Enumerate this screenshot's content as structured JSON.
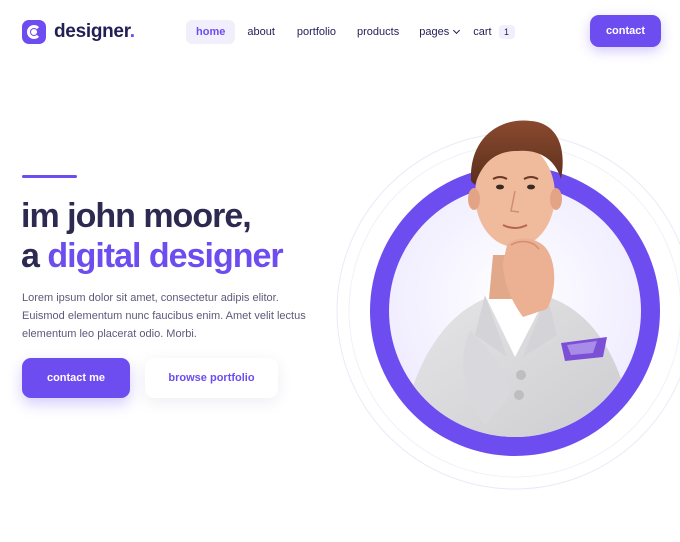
{
  "header": {
    "logo_text": "designer",
    "logo_dot": ".",
    "nav": {
      "home": "home",
      "about": "about",
      "portfolio": "portfolio",
      "products": "products",
      "pages": "pages",
      "cart": "cart",
      "cart_count": "1"
    },
    "contact_label": "contact"
  },
  "hero": {
    "line1": "im john moore,",
    "line2_prefix": "a ",
    "line2_highlight": "digital designer",
    "body": "Lorem ipsum dolor sit amet, consectetur adipis elitor. Euismod elementum nunc faucibus enim. Amet velit lectus elementum leo placerat odio. Morbi.",
    "primary_cta": "contact me",
    "secondary_cta": "browse portfolio"
  },
  "colors": {
    "accent": "#6d4cf0",
    "heading": "#2d2a52",
    "body": "#5c5a7a",
    "nav_active_bg": "#f2effd"
  },
  "icons": {
    "logo": "logo-mark-icon",
    "pages_dropdown": "chevron-down-icon"
  }
}
